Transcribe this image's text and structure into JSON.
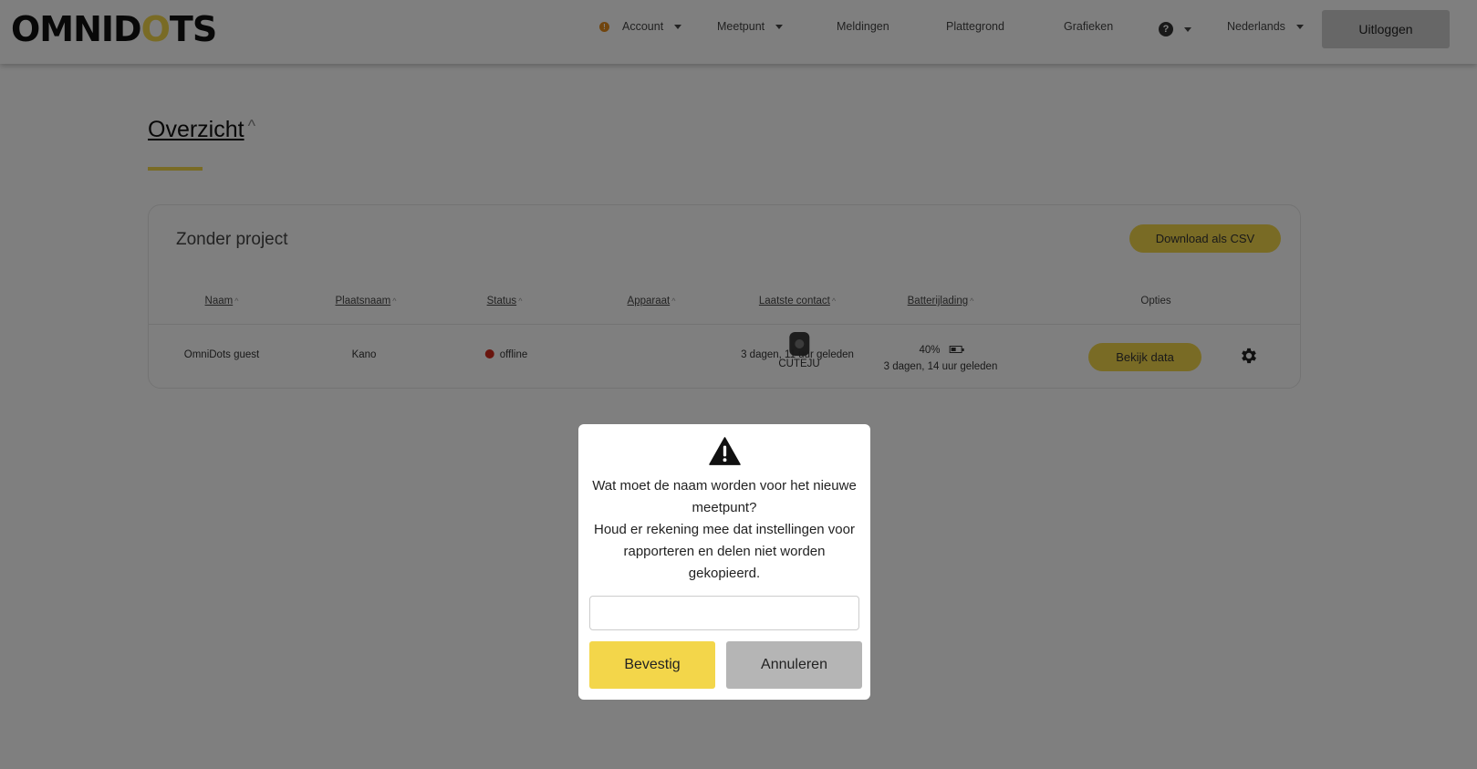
{
  "header": {
    "logo_text_pre": "OMNID",
    "logo_text_o": "O",
    "logo_text_post": "TS",
    "nav": {
      "account": "Account",
      "meetpunt": "Meetpunt",
      "meldingen": "Meldingen",
      "plattegrond": "Plattegrond",
      "grafieken": "Grafieken",
      "help_glyph": "?",
      "language": "Nederlands"
    },
    "logout": "Uitloggen"
  },
  "page": {
    "title": "Overzicht",
    "title_sort": "^"
  },
  "card": {
    "title": "Zonder project",
    "csv_button": "Download als CSV",
    "columns": {
      "naam": "Naam",
      "plaatsnaam": "Plaatsnaam",
      "status": "Status",
      "apparaat": "Apparaat",
      "laatste_contact": "Laatste contact",
      "batterijlading": "Batterijlading",
      "opties": "Opties"
    },
    "sort_glyph": "^",
    "row": {
      "naam": "OmniDots guest",
      "plaatsnaam": "Kano",
      "status": "offline",
      "apparaat": "CUTEJU",
      "laatste_contact": "3 dagen, 11 uur geleden",
      "battery_percent": "40%",
      "battery_time": "3 dagen, 14 uur geleden",
      "view_button": "Bekijk data"
    }
  },
  "modal": {
    "line1": "Wat moet de naam worden voor het nieuwe meetpunt?",
    "line2": "Houd er rekening mee dat instellingen voor rapporteren en delen niet worden gekopieerd.",
    "input_value": "",
    "confirm": "Bevestig",
    "cancel": "Annuleren"
  },
  "colors": {
    "accent": "#f3d64a",
    "status_offline": "#d32a1c",
    "warning": "#e28a1d"
  }
}
